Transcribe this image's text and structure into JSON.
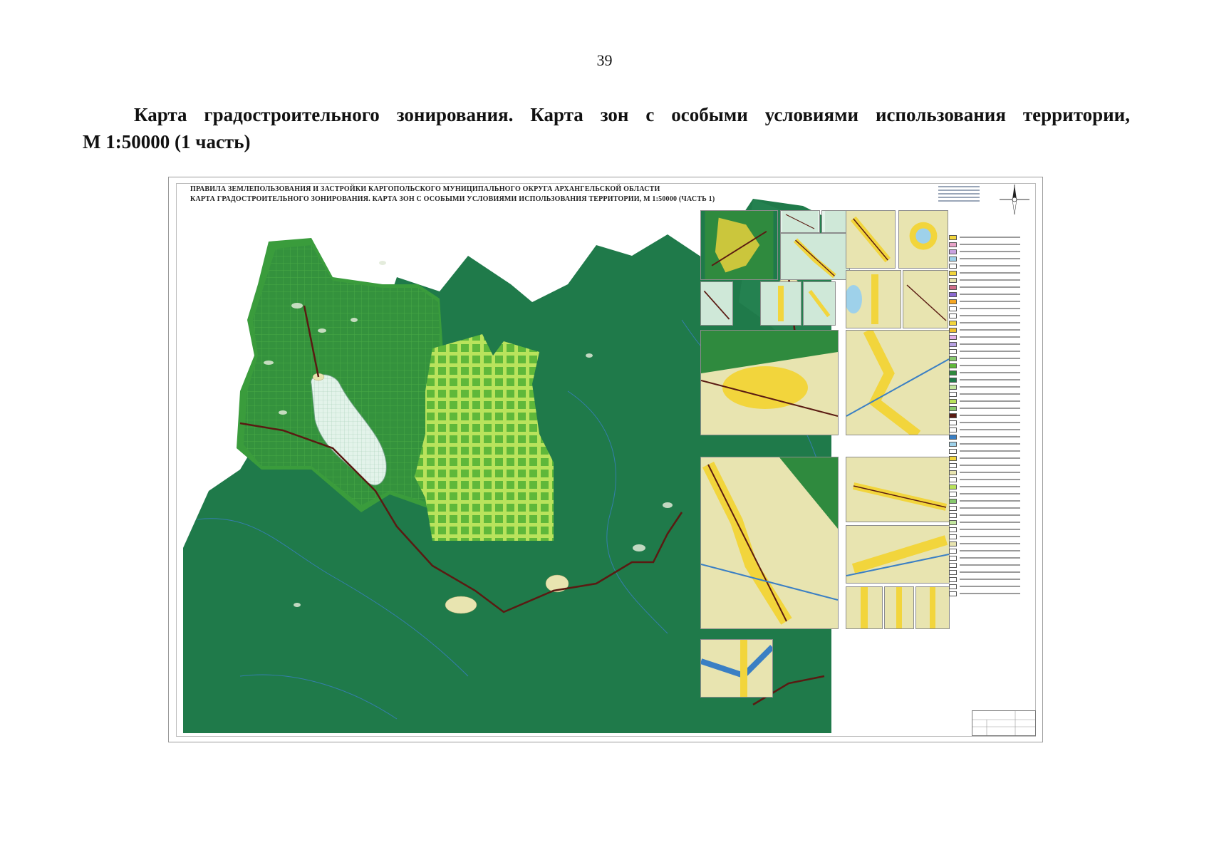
{
  "page": {
    "number": "39",
    "caption_line1": "Карта градостроительного зонирования. Карта зон с особыми условиями использования территории,",
    "caption_line2": "М 1:50000 (1 часть)"
  },
  "map_sheet": {
    "title_line1": "ПРАВИЛА ЗЕМЛЕПОЛЬЗОВАНИЯ И ЗАСТРОЙКИ КАРГОПОЛЬСКОГО МУНИЦИПАЛЬНОГО ОКРУГА АРХАНГЕЛЬСКОЙ ОБЛАСТИ",
    "title_line2": "КАРТА ГРАДОСТРОИТЕЛЬНОГО ЗОНИРОВАНИЯ. КАРТА ЗОН С ОСОБЫМИ УСЛОВИЯМИ ИСПОЛЬЗОВАНИЯ ТЕРРИТОРИИ, М 1:50000 (ЧАСТЬ 1)",
    "north_arrow_icon": "compass-rose-icon",
    "colors": {
      "forest_zone": "#1f7a4a",
      "light_forest_zone": "#3c9a3a",
      "hatched_protected_zone": "#7fd15a",
      "lake": "#d6efe3",
      "settlement": "#f2d53c",
      "road": "#5a1a12",
      "river": "#3a7fc4",
      "agricultural": "#e8e4b0"
    }
  }
}
